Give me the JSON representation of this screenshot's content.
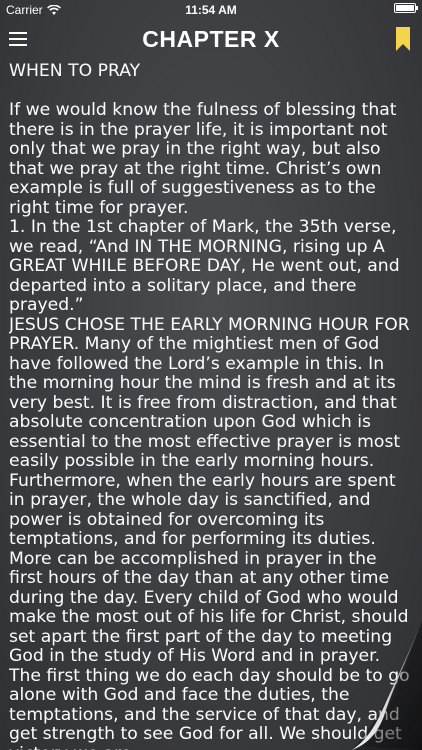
{
  "status_bar": {
    "carrier": "Carrier",
    "time": "11:54 AM"
  },
  "nav": {
    "title": "CHAPTER X",
    "menu_icon": "hamburger-menu-icon",
    "bookmark_icon": "bookmark-icon",
    "bookmark_color": "#f4d44c"
  },
  "content": {
    "heading": "WHEN TO PRAY",
    "paragraphs": [
      "If we would know the fulness of blessing that there is in the prayer life, it is important not only that we pray in the right way, but also that we pray at the right time. Christ’s own example is full of suggestiveness as to the right time for prayer.",
      "1. In the 1st chapter of Mark, the 35th verse, we read, “And IN THE MORNING, rising up A GREAT WHILE BEFORE DAY, He went out, and departed into a solitary place, and there prayed.”",
      "JESUS CHOSE THE EARLY MORNING HOUR FOR PRAYER. Many of the mightiest men of God have followed the Lord’s example in this. In the morning hour the mind is fresh and at its very best. It is free from distraction, and that absolute concentration upon God which is essential to the most effective prayer is most easily possible in the early morning hours. Furthermore, when the early hours are spent in prayer, the whole day is sanctified, and power is obtained for overcoming its temptations, and for performing its duties. More can be accomplished in prayer in the first hours of the day than at any other time during the day. Every child of God who would make the most out of his life for Christ, should set apart the first part of the day to meeting God in the study of His Word and in prayer. The first thing we do each day should be to go alone with God and face the duties, the temptations, and the service of that day, and get strength to see God for all. We should get victory we are"
    ]
  }
}
